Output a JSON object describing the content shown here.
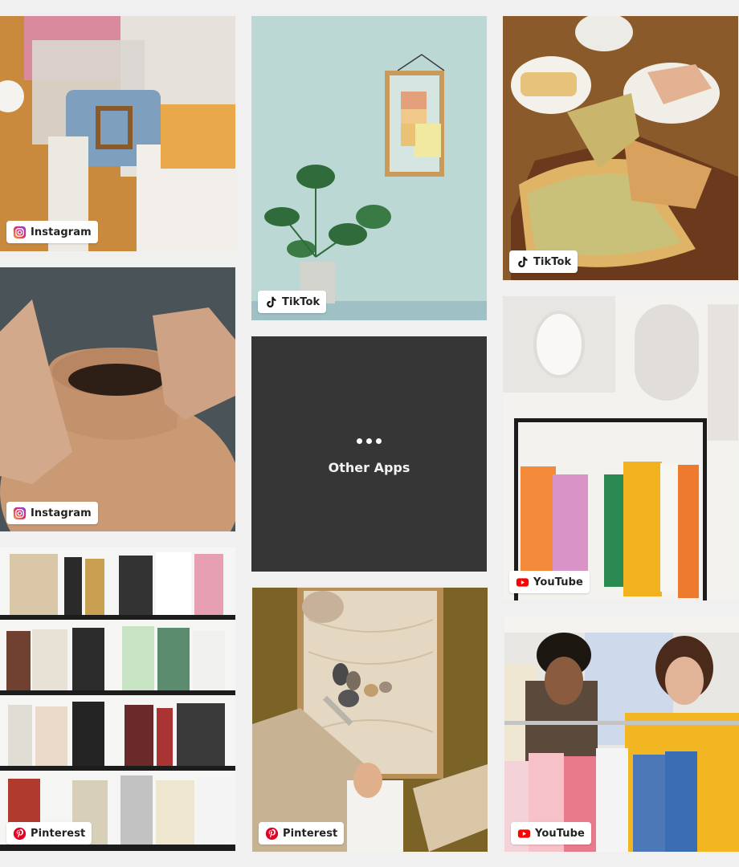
{
  "tiles": [
    {
      "id": "t1",
      "platform": "Instagram"
    },
    {
      "id": "t2",
      "platform": "TikTok"
    },
    {
      "id": "t3",
      "platform": "TikTok"
    },
    {
      "id": "t4",
      "platform": "Instagram"
    },
    {
      "id": "t5",
      "platform": "YouTube"
    },
    {
      "id": "t6",
      "platform": "Pinterest"
    },
    {
      "id": "t7",
      "platform": "Pinterest"
    },
    {
      "id": "t8",
      "platform": "YouTube"
    }
  ],
  "other_apps": {
    "label": "Other Apps",
    "icon": "more-dots-icon"
  },
  "icons": {
    "instagram": "instagram-icon",
    "tiktok": "tiktok-icon",
    "youtube": "youtube-icon",
    "pinterest": "pinterest-icon"
  },
  "colors": {
    "page_bg": "#f0f0f0",
    "other_bg": "#363636",
    "youtube_red": "#ff0000",
    "pinterest_red": "#e60023"
  }
}
